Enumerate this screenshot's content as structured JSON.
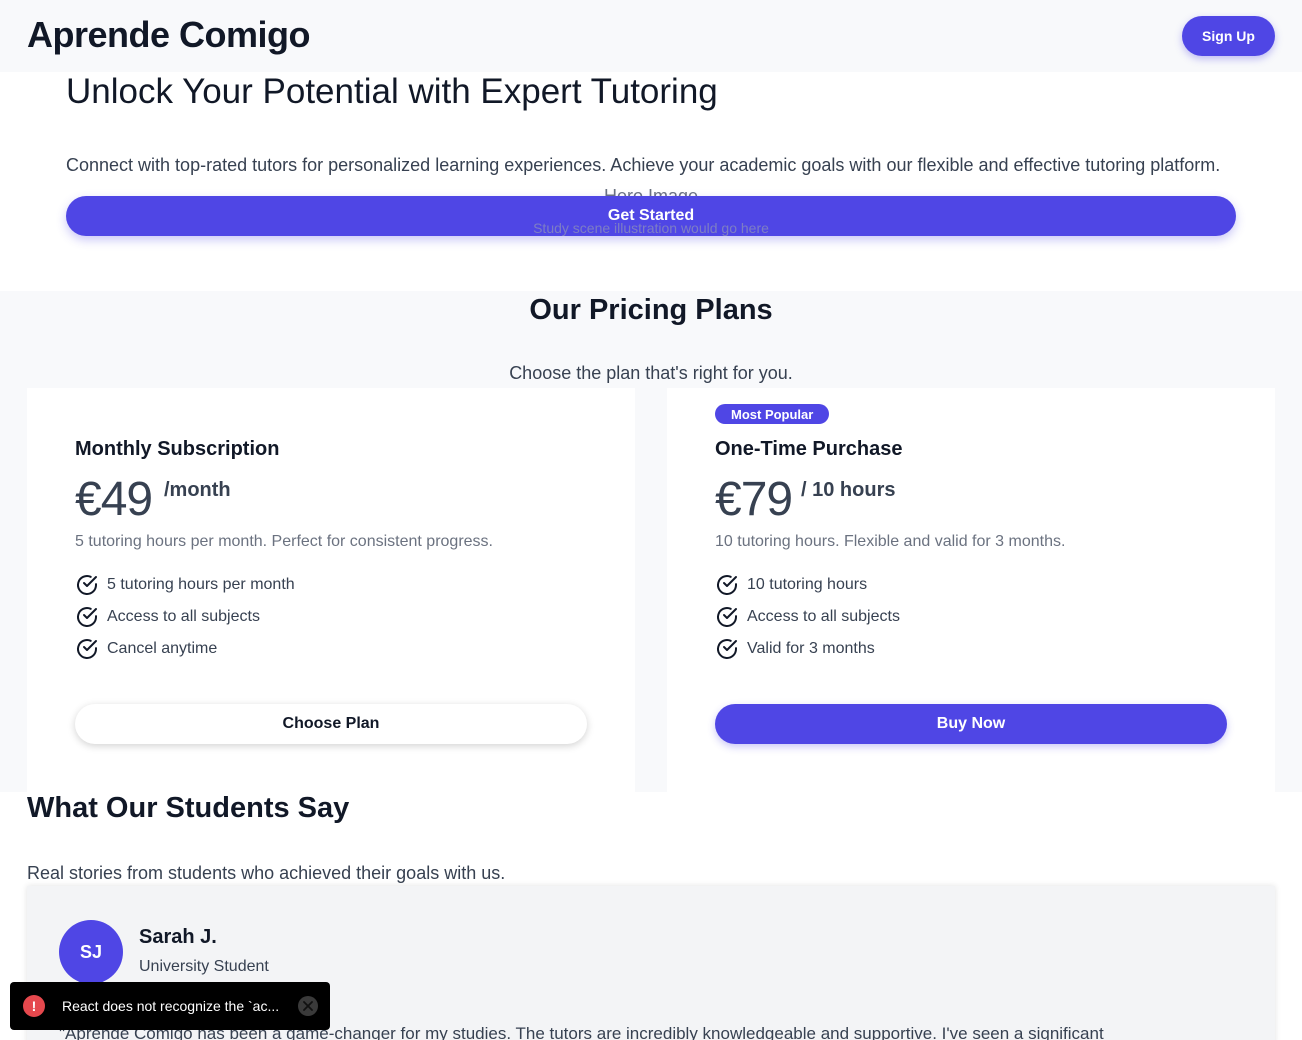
{
  "header": {
    "brand": "Aprende Comigo",
    "signup_label": "Sign Up"
  },
  "hero": {
    "title": "Unlock Your Potential with Expert Tutoring",
    "subtitle": "Connect with top-rated tutors for personalized learning experiences. Achieve your academic goals with our flexible and effective tutoring platform.",
    "image_title": "Hero Image",
    "cta_label": "Get Started",
    "image_caption": "Study scene illustration would go here"
  },
  "pricing": {
    "title": "Our Pricing Plans",
    "subtitle": "Choose the plan that's right for you.",
    "plans": [
      {
        "name": "Monthly Subscription",
        "price": "€49",
        "period": "/month",
        "description": "5 tutoring hours per month. Perfect for consistent progress.",
        "features": [
          "5 tutoring hours per month",
          "Access to all subjects",
          "Cancel anytime"
        ],
        "button_label": "Choose Plan"
      },
      {
        "badge": "Most Popular",
        "name": "One-Time Purchase",
        "price": "€79",
        "period": "/ 10 hours",
        "description": "10 tutoring hours. Flexible and valid for 3 months.",
        "features": [
          "10 tutoring hours",
          "Access to all subjects",
          "Valid for 3 months"
        ],
        "button_label": "Buy Now"
      }
    ]
  },
  "testimonials": {
    "title": "What Our Students Say",
    "subtitle": "Real stories from students who achieved their goals with us.",
    "items": [
      {
        "initials": "SJ",
        "name": "Sarah J.",
        "role": "University Student",
        "quote": "\"Aprende Comigo has been a game-changer for my studies. The tutors are incredibly knowledgeable and supportive. I've seen a significant"
      }
    ]
  },
  "toast": {
    "icon": "!",
    "message": "React does not recognize the `ac..."
  },
  "colors": {
    "accent": "#4f46e5",
    "page_bg": "#f8f9fb",
    "text": "#111827",
    "muted": "#6b7280",
    "error": "#e5484d"
  }
}
